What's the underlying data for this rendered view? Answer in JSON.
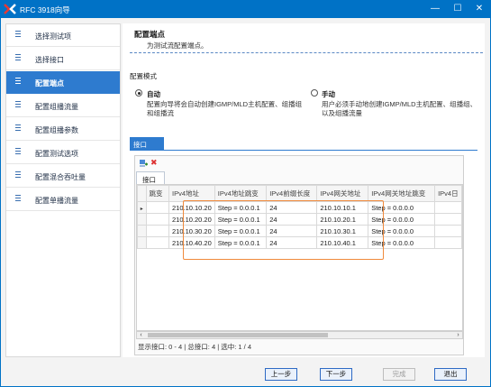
{
  "window": {
    "title": "RFC 3918向导",
    "controls": {
      "minimize": "—",
      "maximize": "☐",
      "close": "✕"
    }
  },
  "sidebar": {
    "items": [
      {
        "label": "选择测试项",
        "active": false
      },
      {
        "label": "选择接口",
        "active": false
      },
      {
        "label": "配置端点",
        "active": true
      },
      {
        "label": "配置组播流量",
        "active": false
      },
      {
        "label": "配置组播参数",
        "active": false
      },
      {
        "label": "配置测试选项",
        "active": false
      },
      {
        "label": "配置混合吞吐量",
        "active": false
      },
      {
        "label": "配置单播流量",
        "active": false
      }
    ]
  },
  "header": {
    "title": "配置端点",
    "subtitle": "为测试流配置端点。"
  },
  "mode": {
    "label": "配置模式",
    "auto": {
      "title": "自动",
      "desc_line1": "配置向导将会自动创建IGMP/MLD主机配置、组播组",
      "desc_line2": "和组播流",
      "selected": true
    },
    "manual": {
      "title": "手动",
      "desc_line1": "用户必须手动地创建IGMP/MLD主机配置、组播组、",
      "desc_line2": "以及组播流量",
      "selected": false
    }
  },
  "iface_tab": "接口",
  "inner_tab": "接口",
  "grid": {
    "columns": [
      "跳变",
      "IPv4地址",
      "IPv4地址跳变",
      "IPv4前缀长度",
      "IPv4网关地址",
      "IPv4网关地址跳变",
      "IPv4日"
    ],
    "rows": [
      [
        "",
        "210.10.10.20",
        "Step = 0.0.0.1",
        "24",
        "210.10.10.1",
        "Step = 0.0.0.0",
        ""
      ],
      [
        "",
        "210.10.20.20",
        "Step = 0.0.0.1",
        "24",
        "210.10.20.1",
        "Step = 0.0.0.0",
        ""
      ],
      [
        "",
        "210.10.30.20",
        "Step = 0.0.0.1",
        "24",
        "210.10.30.1",
        "Step = 0.0.0.0",
        ""
      ],
      [
        "",
        "210.10.40.20",
        "Step = 0.0.0.1",
        "24",
        "210.10.40.1",
        "Step = 0.0.0.0",
        ""
      ]
    ],
    "current_row_marker": "▸"
  },
  "status": "显示接口: 0 - 4 | 总接口: 4 | 选中: 1 / 4",
  "buttons": {
    "prev": "上一步",
    "next": "下一步",
    "finish": "完成",
    "exit": "退出"
  },
  "colors": {
    "accent": "#0072c6",
    "active_item": "#2e7bcf",
    "highlight": "#f08a3c"
  }
}
